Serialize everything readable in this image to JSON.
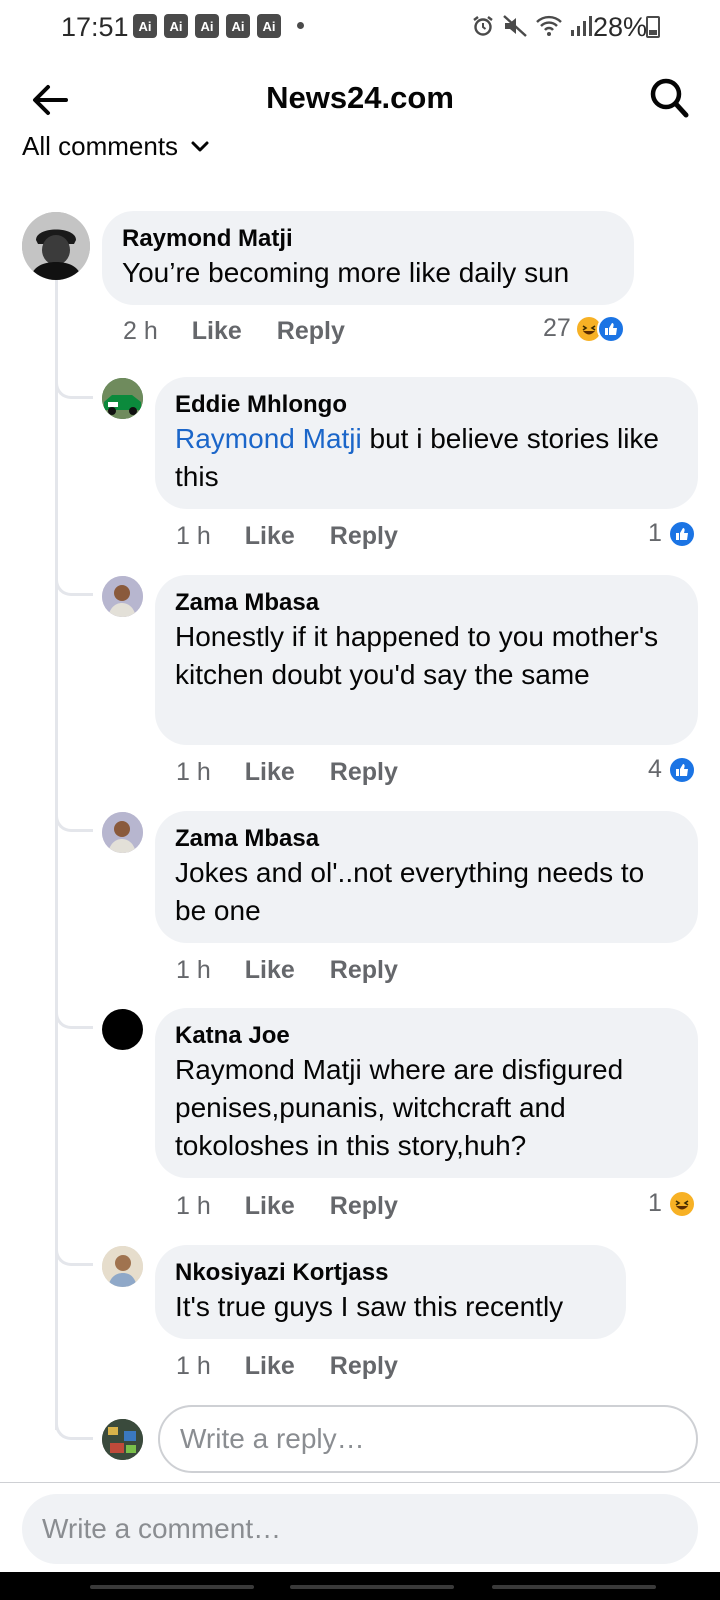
{
  "status_bar": {
    "time": "17:51",
    "ai_badges": [
      "Ai",
      "Ai",
      "Ai",
      "Ai",
      "Ai"
    ],
    "battery": "28%",
    "icons": [
      "alarm-icon",
      "mute-icon",
      "wifi-icon",
      "signal-icon",
      "battery-icon"
    ]
  },
  "header": {
    "title": "News24.com",
    "back_icon": "arrow-left-icon",
    "search_icon": "search-icon"
  },
  "filter": {
    "label": "All comments"
  },
  "comments": [
    {
      "author": "Raymond Matji",
      "text": "You’re becoming more like daily sun",
      "time": "2 h",
      "like_label": "Like",
      "reply_label": "Reply",
      "reaction_count": "27",
      "reactions": [
        "haha",
        "like"
      ]
    },
    {
      "author": "Eddie Mhlongo",
      "mention": "Raymond Matji",
      "text": " but i believe stories like this",
      "time": "1 h",
      "like_label": "Like",
      "reply_label": "Reply",
      "reaction_count": "1",
      "reactions": [
        "like"
      ]
    },
    {
      "author": "Zama Mbasa",
      "text": "Honestly if it happened to you mother's kitchen doubt you'd say the same",
      "time": "1 h",
      "like_label": "Like",
      "reply_label": "Reply",
      "reaction_count": "4",
      "reactions": [
        "like"
      ]
    },
    {
      "author": "Zama Mbasa",
      "text": "Jokes and ol'..not everything needs to be one",
      "time": "1 h",
      "like_label": "Like",
      "reply_label": "Reply"
    },
    {
      "author": "Katna Joe",
      "text": "Raymond Matji where are disfigured penises,punanis, witchcraft and tokoloshes in this story,huh?",
      "time": "1 h",
      "like_label": "Like",
      "reply_label": "Reply",
      "reaction_count": "1",
      "reactions": [
        "haha"
      ]
    },
    {
      "author": "Nkosiyazi Kortjass",
      "text": "It's true guys I saw this recently",
      "time": "1 h",
      "like_label": "Like",
      "reply_label": "Reply"
    }
  ],
  "reply_composer": {
    "placeholder": "Write a reply…"
  },
  "comment_composer": {
    "placeholder": "Write a comment…"
  },
  "colors": {
    "bubble": "#f0f2f5",
    "mention": "#1b66c9",
    "like_reaction": "#1b74e4",
    "haha_reaction": "#f7b125",
    "meta_text": "#65676b"
  }
}
